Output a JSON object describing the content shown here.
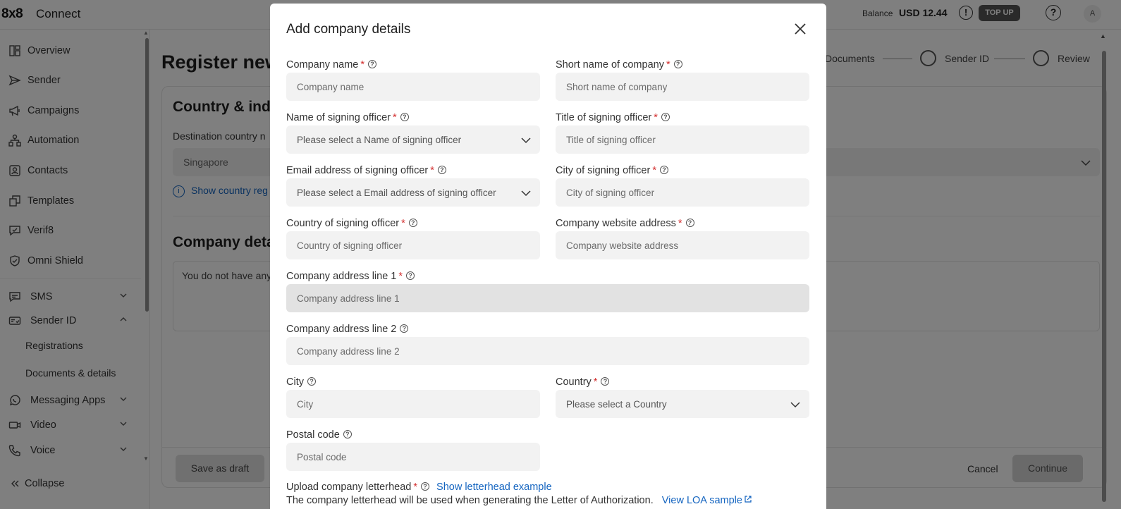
{
  "topbar": {
    "brand": "8x8",
    "app_name": "Connect",
    "balance_label": "Balance",
    "balance_value": "USD 12.44",
    "alert_glyph": "!",
    "topup_label": "TOP UP",
    "help_glyph": "?",
    "avatar_initial": "A"
  },
  "sidebar": {
    "items": [
      {
        "label": "Overview",
        "icon": "dashboard-icon"
      },
      {
        "label": "Sender",
        "icon": "send-icon"
      },
      {
        "label": "Campaigns",
        "icon": "megaphone-icon"
      },
      {
        "label": "Automation",
        "icon": "flow-icon"
      },
      {
        "label": "Contacts",
        "icon": "contacts-icon"
      },
      {
        "label": "Templates",
        "icon": "templates-icon"
      },
      {
        "label": "Verif8",
        "icon": "verify-chat-icon"
      },
      {
        "label": "Omni Shield",
        "icon": "shield-icon"
      }
    ],
    "groups": [
      {
        "label": "SMS",
        "icon": "chat-icon",
        "expanded": false
      },
      {
        "label": "Sender ID",
        "icon": "id-card-icon",
        "expanded": true
      },
      {
        "label": "Messaging Apps",
        "icon": "whatsapp-icon",
        "expanded": false
      },
      {
        "label": "Video",
        "icon": "video-icon",
        "expanded": false
      },
      {
        "label": "Voice",
        "icon": "phone-icon",
        "expanded": false
      }
    ],
    "sender_id_sub": [
      "Registrations",
      "Documents & details"
    ],
    "collapse_label": "Collapse"
  },
  "page": {
    "title": "Register new",
    "section1_title": "Country & indu",
    "destination_label": "Destination country n",
    "destination_value": "Singapore",
    "show_country_link": "Show country reg",
    "section2_title": "Company detai",
    "empty_text": "You do not have any",
    "save_draft_label": "Save as draft",
    "cancel_label": "Cancel",
    "continue_label": "Continue",
    "steps": [
      "Documents",
      "Sender ID",
      "Review"
    ]
  },
  "modal": {
    "title": "Add company details",
    "fields": {
      "company_name": {
        "label": "Company name",
        "placeholder": "Company name"
      },
      "short_name": {
        "label": "Short name of company",
        "placeholder": "Short name of company"
      },
      "signing_officer_name": {
        "label": "Name of signing officer",
        "placeholder": "Please select a Name of signing officer"
      },
      "signing_officer_title": {
        "label": "Title of signing officer",
        "placeholder": "Title of signing officer"
      },
      "signing_officer_email": {
        "label": "Email address of signing officer",
        "placeholder": "Please select a Email address of signing officer"
      },
      "signing_officer_city": {
        "label": "City of signing officer",
        "placeholder": "City of signing officer"
      },
      "signing_officer_country": {
        "label": "Country of signing officer",
        "placeholder": "Country of signing officer"
      },
      "website": {
        "label": "Company website address",
        "placeholder": "Company website address"
      },
      "address1": {
        "label": "Company address line 1",
        "placeholder": "Company address line 1"
      },
      "address2": {
        "label": "Company address line 2",
        "placeholder": "Company address line 2"
      },
      "city": {
        "label": "City",
        "placeholder": "City"
      },
      "country": {
        "label": "Country",
        "placeholder": "Please select a Country"
      },
      "postal_code": {
        "label": "Postal code",
        "placeholder": "Postal code"
      }
    },
    "required_mark": "*",
    "help_glyph": "?",
    "upload_label": "Upload company letterhead",
    "letterhead_link": "Show letterhead example",
    "letterhead_note": "The company letterhead will be used when generating the Letter of Authorization.",
    "loa_link": "View LOA sample"
  },
  "colors": {
    "accent_link": "#1565c0",
    "required": "#d32f2f",
    "topup_bg": "#555555"
  }
}
